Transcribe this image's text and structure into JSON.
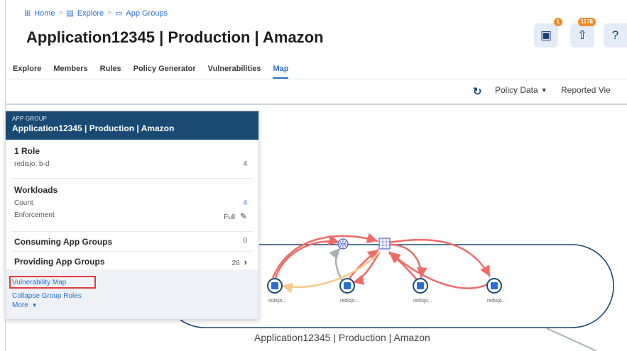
{
  "breadcrumb": {
    "home": "Home",
    "explore": "Explore",
    "app_groups": "App Groups"
  },
  "page": {
    "title": "Application12345 | Production | Amazon"
  },
  "header_buttons": {
    "notif_count": "1",
    "upload_count": "1178",
    "help_label": "?"
  },
  "tabs": [
    "Explore",
    "Members",
    "Rules",
    "Policy Generator",
    "Vulnerabilities",
    "Map"
  ],
  "toolbar": {
    "policy_data": "Policy Data",
    "reported_view": "Reported Vie"
  },
  "panel": {
    "kicker": "APP GROUP",
    "name": "Application12345 | Production | Amazon",
    "role_heading": "1 Role",
    "role_name": "redisjo. b-d",
    "role_count": "4",
    "workloads_heading": "Workloads",
    "count_label": "Count",
    "count_value": "4",
    "enforcement_label": "Enforcement",
    "enforcement_value": "Full",
    "consuming_label": "Consuming App Groups",
    "consuming_value": "0",
    "providing_label": "Providing App Groups",
    "providing_value": "26",
    "vuln_map_link": "Vulnerability Map",
    "collapse_link": "Collapse Group Roles",
    "more_link": "More"
  },
  "map": {
    "group_label": "Application12345 | Production | Amazon",
    "node_labels": [
      "redisjo...",
      "redisjo...",
      "redisjo...",
      "redisjo..."
    ]
  },
  "colors": {
    "accent": "#2a6fd6",
    "panel_header": "#1a4a72",
    "arrow_red": "#ee6b67",
    "arrow_yellow": "#f7c98a",
    "arrow_gray": "#a9b0b5",
    "highlight": "#e23b3b"
  }
}
